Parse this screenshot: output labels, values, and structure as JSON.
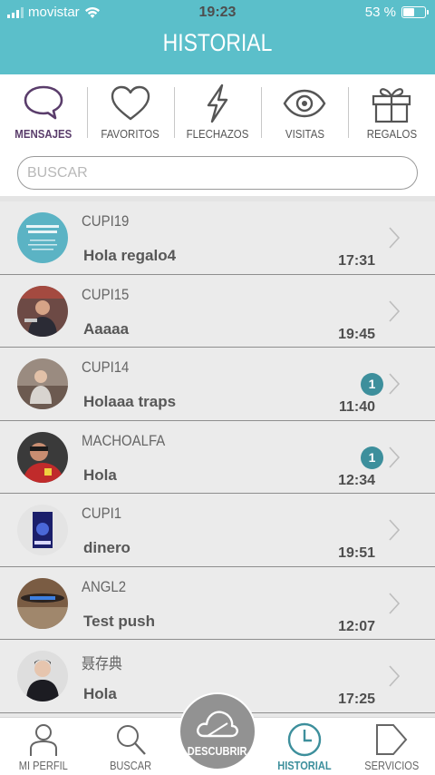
{
  "status_bar": {
    "carrier": "movistar",
    "time": "19:23",
    "battery": "53 %",
    "battery_level": 0.53
  },
  "header": {
    "title": "HISTORIAL"
  },
  "tabs": [
    {
      "label": "MENSAJES",
      "icon": "chat-bubble-icon",
      "active": true
    },
    {
      "label": "FAVORITOS",
      "icon": "heart-icon",
      "active": false
    },
    {
      "label": "FLECHAZOS",
      "icon": "lightning-icon",
      "active": false
    },
    {
      "label": "VISITAS",
      "icon": "eye-icon",
      "active": false
    },
    {
      "label": "REGALOS",
      "icon": "gift-icon",
      "active": false
    }
  ],
  "search": {
    "placeholder": "BUSCAR",
    "value": ""
  },
  "conversations": [
    {
      "name": "CUPI19",
      "message": "Hola regalo4",
      "time": "17:31",
      "unread": null
    },
    {
      "name": "CUPI15",
      "message": "Aaaaa",
      "time": "19:45",
      "unread": null
    },
    {
      "name": "CUPI14",
      "message": "Holaaa traps",
      "time": "11:40",
      "unread": "1"
    },
    {
      "name": "MACHOALFA",
      "message": "Hola",
      "time": "12:34",
      "unread": "1"
    },
    {
      "name": "CUPI1",
      "message": "dinero",
      "time": "19:51",
      "unread": null
    },
    {
      "name": "ANGL2",
      "message": "Test push",
      "time": "12:07",
      "unread": null
    },
    {
      "name": "聂存典",
      "message": "Hola",
      "time": "17:25",
      "unread": null
    }
  ],
  "bottom_nav": [
    {
      "label": "MI PERFIL",
      "icon": "user-icon",
      "active": false
    },
    {
      "label": "BUSCAR",
      "icon": "search-icon",
      "active": false
    },
    {
      "label": "DESCUBRIR",
      "icon": "cloud-icon",
      "active": false
    },
    {
      "label": "HISTORIAL",
      "icon": "clock-icon",
      "active": true
    },
    {
      "label": "SERVICIOS",
      "icon": "tag-arrow-icon",
      "active": false
    }
  ],
  "colors": {
    "header": "#5bbfca",
    "accent": "#3d8f9c",
    "active_tab": "#5a3d6b"
  }
}
